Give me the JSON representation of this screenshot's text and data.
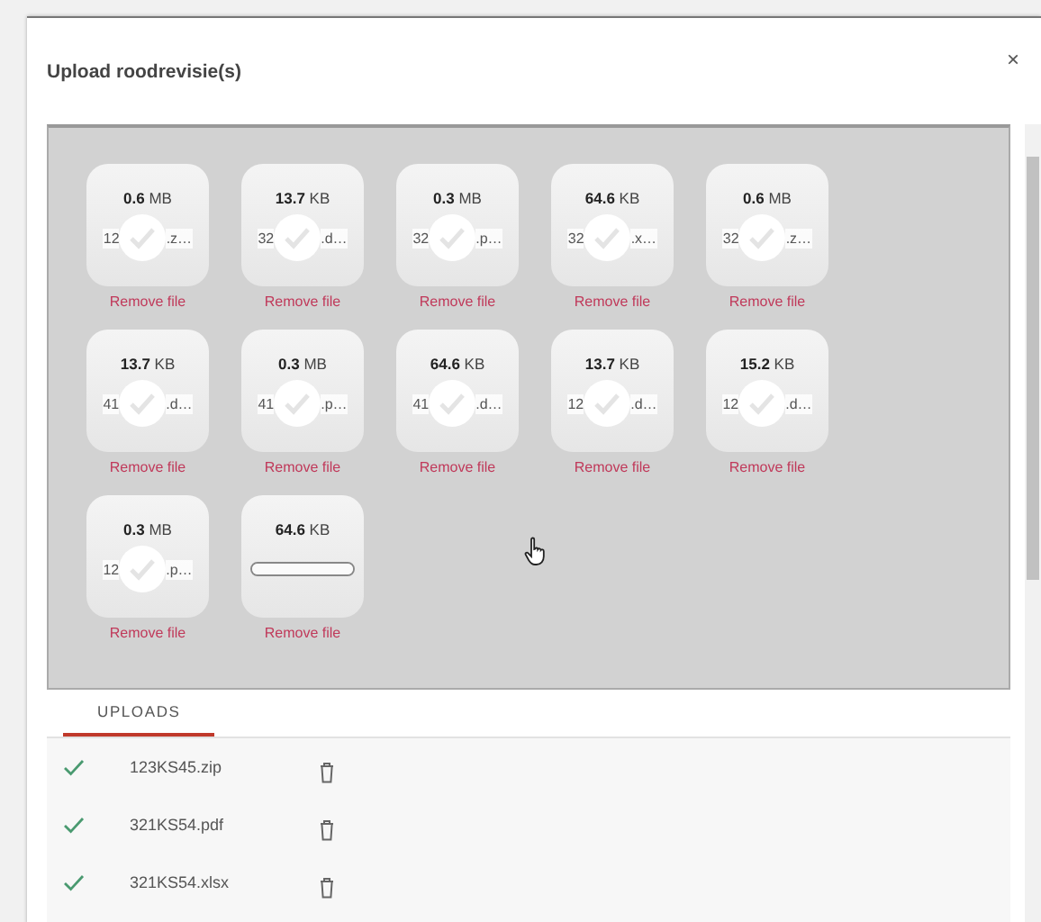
{
  "dialog": {
    "title": "Upload roodrevisie(s)",
    "close": "×"
  },
  "files": [
    {
      "kind": "done",
      "size": "**0.6** MB",
      "name_start": "12",
      "name_end": ".z…",
      "remove": "Remove file"
    },
    {
      "kind": "done",
      "size": "**13.7** KB",
      "name_start": "32",
      "name_end": ".d…",
      "remove": "Remove file"
    },
    {
      "kind": "done",
      "size": "**0.3** MB",
      "name_start": "32",
      "name_end": ".p…",
      "remove": "Remove file"
    },
    {
      "kind": "done",
      "size": "**64.6** KB",
      "name_start": "32",
      "name_end": ".x…",
      "remove": "Remove file"
    },
    {
      "kind": "done",
      "size": "**0.6** MB",
      "name_start": "32",
      "name_end": ".z…",
      "remove": "Remove file"
    },
    {
      "kind": "done",
      "size": "**13.7** KB",
      "name_start": "41",
      "name_end": ".d…",
      "remove": "Remove file"
    },
    {
      "kind": "done",
      "size": "**0.3** MB",
      "name_start": "41",
      "name_end": ".p…",
      "remove": "Remove file"
    },
    {
      "kind": "done",
      "size": "**64.6** KB",
      "name_start": "41",
      "name_end": ".d…",
      "remove": "Remove file"
    },
    {
      "kind": "done",
      "size": "**13.7** KB",
      "name_start": "12",
      "name_end": ".d…",
      "remove": "Remove file"
    },
    {
      "kind": "done",
      "size": "**15.2** KB",
      "name_start": "12",
      "name_end": ".d…",
      "remove": "Remove file"
    },
    {
      "kind": "done",
      "size": "**0.3** MB",
      "name_start": "12",
      "name_end": ".p…",
      "remove": "Remove file"
    },
    {
      "kind": "uploading",
      "size": "**64.6** KB",
      "level": 1,
      "remove": "Remove file"
    }
  ],
  "tabs": [
    {
      "label": "UPLOADS",
      "selected": true
    }
  ],
  "uploads": [
    {
      "name": "123KS45.zip",
      "done": true
    },
    {
      "name": "321KS54.pdf",
      "done": true
    },
    {
      "name": "321KS54.xlsx",
      "done": true
    }
  ]
}
